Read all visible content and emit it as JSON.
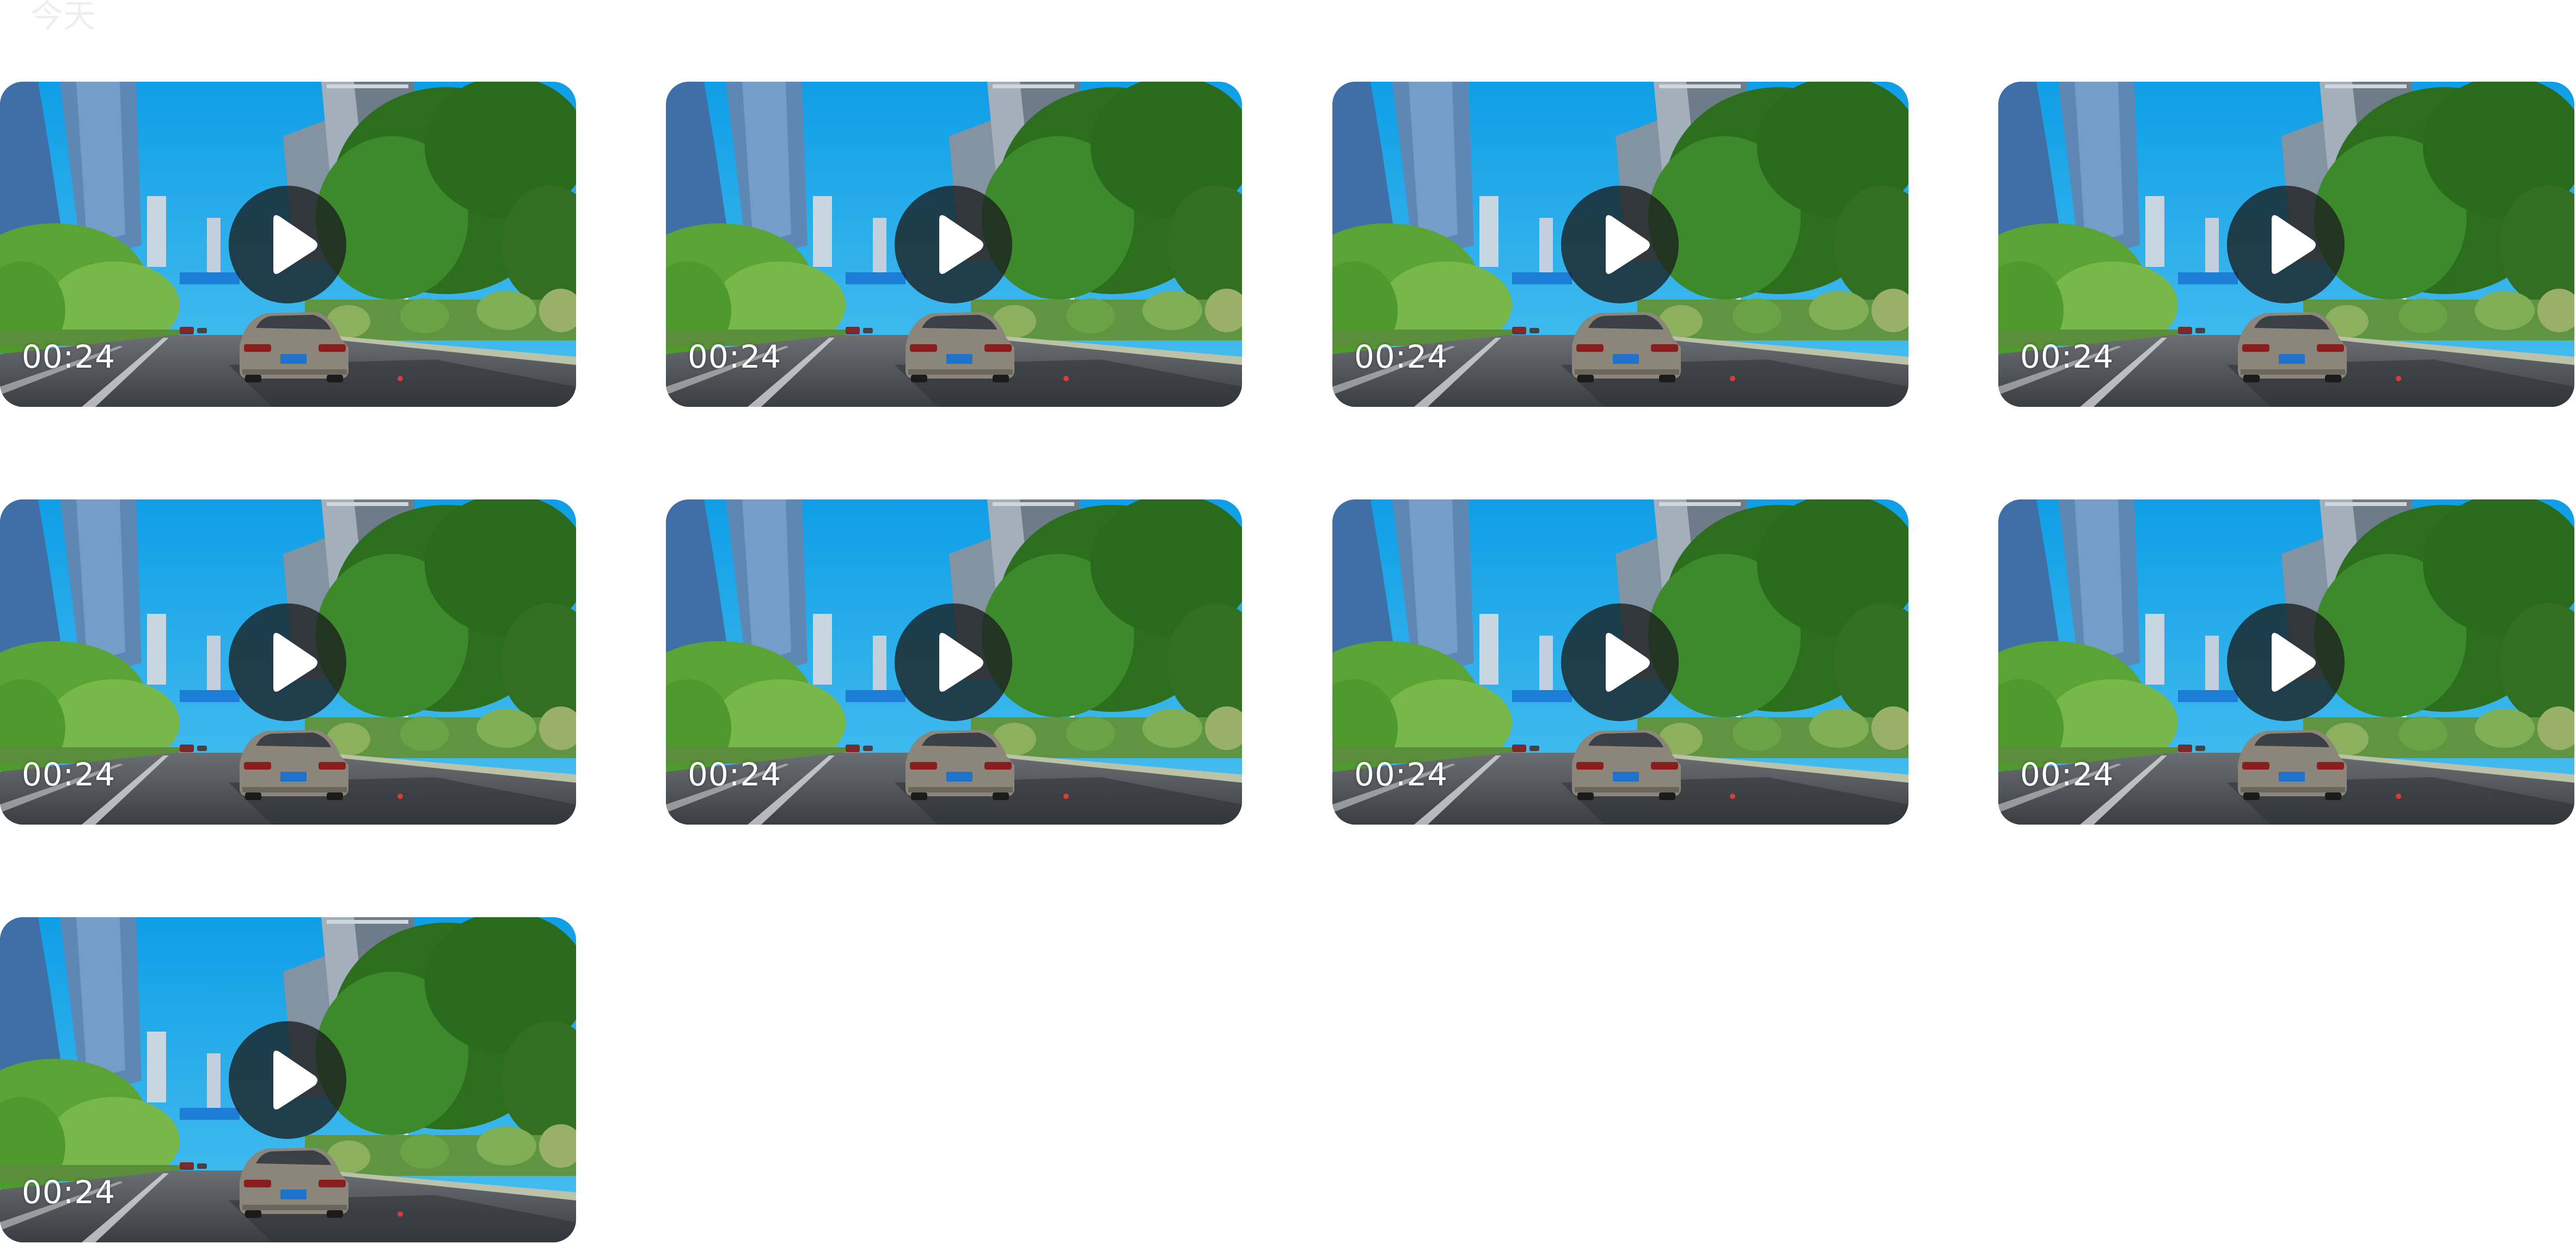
{
  "section": {
    "title": "今天"
  },
  "videos": [
    {
      "duration": "00:24"
    },
    {
      "duration": "00:24"
    },
    {
      "duration": "00:24"
    },
    {
      "duration": "00:24"
    },
    {
      "duration": "00:24"
    },
    {
      "duration": "00:24"
    },
    {
      "duration": "00:24"
    },
    {
      "duration": "00:24"
    },
    {
      "duration": "00:24"
    }
  ],
  "colors": {
    "sky": "#1aa7e6",
    "tree": "#2f7a22",
    "road": "#4b4f55",
    "overlay": "#191e1e"
  },
  "icons": {
    "play": "play-icon"
  }
}
